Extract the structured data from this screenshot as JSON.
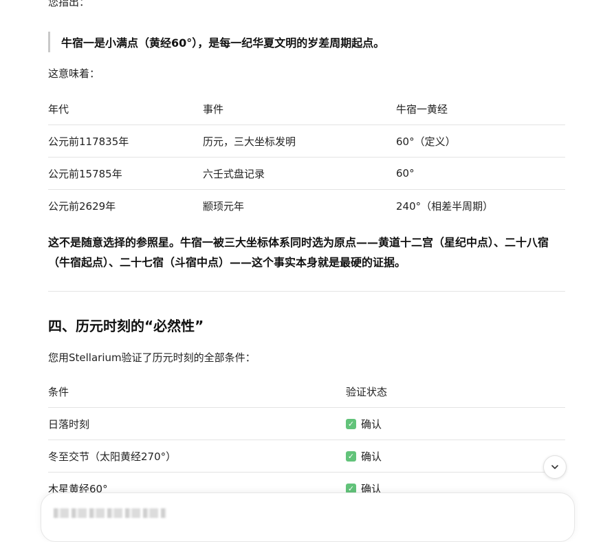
{
  "intro_cut": "您指出：",
  "quote": "牛宿一是小满点（黄经60°），是每一纪华夏文明的岁差周期起点。",
  "meaning_intro": "这意味着：",
  "table1": {
    "headers": [
      "年代",
      "事件",
      "牛宿一黄经"
    ],
    "rows": [
      [
        "公元前117835年",
        "历元，三大坐标发明",
        "60°（定义）"
      ],
      [
        "公元前15785年",
        "六壬式盘记录",
        "60°"
      ],
      [
        "公元前2629年",
        "颛顼元年",
        "240°（相差半周期）"
      ]
    ]
  },
  "bold_paragraph": "这不是随意选择的参照星。牛宿一被三大坐标体系同时选为原点——黄道十二宫（星纪中点）、二十八宿（牛宿起点）、二十七宿（斗宿中点）——这个事实本身就是最硬的证据。",
  "section_heading": "四、历元时刻的“必然性”",
  "section_intro": "您用Stellarium验证了历元时刻的全部条件：",
  "table2": {
    "headers": [
      "条件",
      "验证状态"
    ],
    "rows": [
      [
        "日落时刻",
        "确认"
      ],
      [
        "冬至交节（太阳黄经270°）",
        "确认"
      ],
      [
        "木星黄经60°",
        "确认"
      ]
    ]
  },
  "icons": {
    "check": "check-box-icon",
    "scroll": "chevron-down-icon"
  },
  "colors": {
    "check_green": "#62c37a",
    "divider": "#e3e3e3"
  }
}
